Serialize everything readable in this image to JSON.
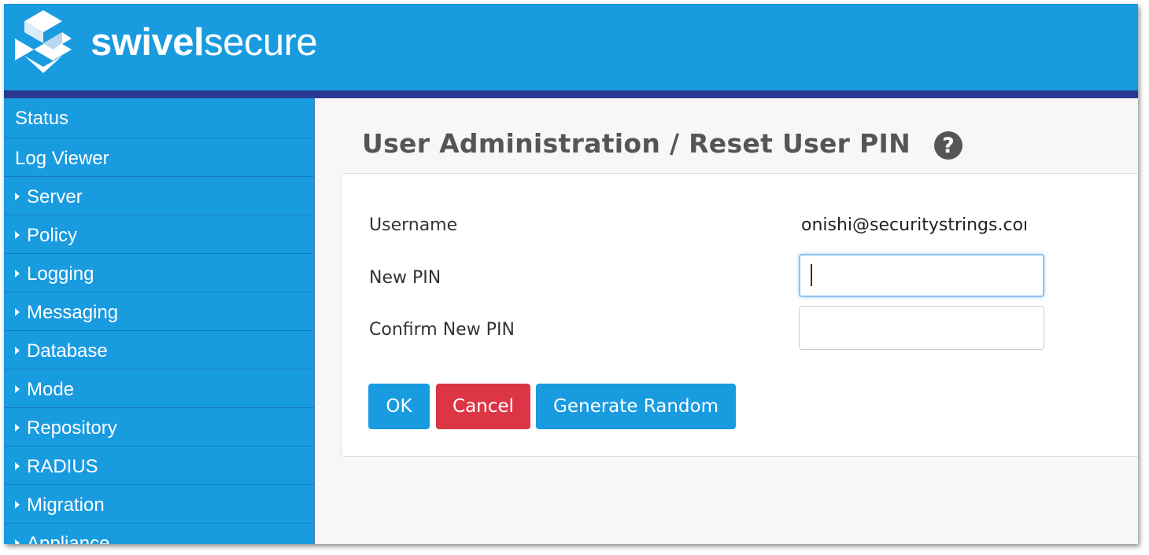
{
  "brand": {
    "name_bold": "swivel",
    "name_light": "secure"
  },
  "sidebar": {
    "items": [
      {
        "label": "Status",
        "expandable": false
      },
      {
        "label": "Log Viewer",
        "expandable": false
      },
      {
        "label": "Server",
        "expandable": true
      },
      {
        "label": "Policy",
        "expandable": true
      },
      {
        "label": "Logging",
        "expandable": true
      },
      {
        "label": "Messaging",
        "expandable": true
      },
      {
        "label": "Database",
        "expandable": true
      },
      {
        "label": "Mode",
        "expandable": true
      },
      {
        "label": "Repository",
        "expandable": true
      },
      {
        "label": "RADIUS",
        "expandable": true
      },
      {
        "label": "Migration",
        "expandable": true
      },
      {
        "label": "Appliance",
        "expandable": true
      }
    ]
  },
  "main": {
    "title": "User Administration  /  Reset User PIN",
    "help_icon": "?",
    "form": {
      "username_label": "Username",
      "username_value": "onishi@securitystrings.com",
      "new_pin_label": "New PIN",
      "new_pin_value": "",
      "confirm_pin_label": "Confirm New PIN",
      "confirm_pin_value": ""
    },
    "buttons": {
      "ok": "OK",
      "cancel": "Cancel",
      "generate": "Generate Random"
    }
  },
  "colors": {
    "brand_blue": "#199be0",
    "header_bar": "#2b3990",
    "cancel_red": "#dc3545",
    "title_gray": "#555555"
  }
}
